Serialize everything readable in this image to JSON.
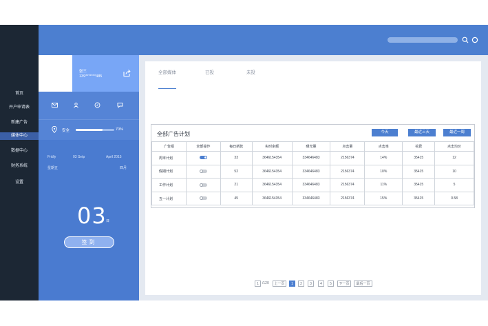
{
  "nav": {
    "items": [
      {
        "label": "首页",
        "active": false
      },
      {
        "label": "开户申请表",
        "active": false
      },
      {
        "label": "新建广告",
        "active": false
      },
      {
        "label": "媒体中心",
        "active": true
      },
      {
        "label": "数据中心",
        "active": false
      },
      {
        "label": "财务系统",
        "active": false
      },
      {
        "label": "设置",
        "active": false
      }
    ]
  },
  "header": {
    "search_placeholder": "",
    "search_icon": "search-icon",
    "user_icon": "user-circle-icon"
  },
  "profile": {
    "name": "张三",
    "phone": "139*******485",
    "share_icon": "share-icon",
    "icons": [
      "mail-icon",
      "user-icon",
      "compass-icon",
      "message-icon"
    ],
    "safety_label": "安全",
    "safety_pct": "70%",
    "safety_value": 0.7
  },
  "calendar": {
    "weekday_en": "Fridly",
    "date_en": "03 Setp",
    "month_year_en": "April  2015",
    "weekday_cn": "星期五",
    "month_cn": "四月",
    "day": "03",
    "day_unit": "日",
    "checkin_label": "签到"
  },
  "tabs": [
    {
      "label": "全部媒体",
      "active": true
    },
    {
      "label": "已投",
      "active": false
    },
    {
      "label": "未投",
      "active": false
    }
  ],
  "plan": {
    "title": "全部广告计划",
    "range_buttons": [
      "今天",
      "最近三天",
      "最近一周"
    ],
    "columns": [
      "广告组",
      "全部操作",
      "每日新款",
      "实时余额",
      "曝光量",
      "点击量",
      "点击率",
      "花费",
      "点击均价"
    ],
    "rows": [
      {
        "name": "周末计划",
        "enabled": true,
        "daily": "33",
        "balance": "3646154354",
        "impressions": "334646483",
        "clicks": "2156374",
        "ctr": "14%",
        "cost": "35415",
        "cpc": "12"
      },
      {
        "name": "假期计划",
        "enabled": false,
        "daily": "52",
        "balance": "3646154354",
        "impressions": "334646483",
        "clicks": "2156374",
        "ctr": "10%",
        "cost": "35415",
        "cpc": "10"
      },
      {
        "name": "工作计划",
        "enabled": false,
        "daily": "21",
        "balance": "3646154354",
        "impressions": "334646483",
        "clicks": "2156374",
        "ctr": "11%",
        "cost": "35415",
        "cpc": "5"
      },
      {
        "name": "五一计划",
        "enabled": false,
        "daily": "45",
        "balance": "3646154354",
        "impressions": "334646483",
        "clicks": "2156374",
        "ctr": "15%",
        "cost": "35415",
        "cpc": "0.58"
      }
    ]
  },
  "pager": {
    "current_box": "1",
    "total": "/120",
    "prev": "上一页",
    "pages": [
      "1",
      "2",
      "3",
      "4",
      "5"
    ],
    "current": "1",
    "next": "下一页",
    "last": "最后一页"
  }
}
